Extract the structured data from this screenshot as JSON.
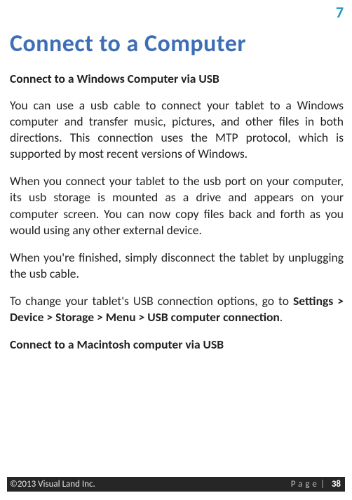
{
  "chapter_number": "7",
  "title": "Connect to a Computer",
  "sections": [
    {
      "heading": "Connect to a Windows Computer via USB",
      "paragraphs": [
        "You can use a usb cable to connect your tablet to a Windows computer and transfer music, pictures, and other files in both directions. This connection uses the MTP protocol, which is supported by most recent versions of Windows.",
        "When you connect your tablet to the usb port on your computer, its usb storage is mounted as a drive and appears on your computer screen. You can now copy files back and forth as you would using any other external device.",
        "When you're finished, simply disconnect the tablet by unplugging the usb cable."
      ],
      "para_settings_prefix": "To change your tablet's USB connection options, go to ",
      "para_settings_bold": "Settings > Device > Storage > Menu > USB computer connection",
      "para_settings_suffix": "."
    },
    {
      "heading": "Connect to a Macintosh computer via USB",
      "paragraphs": []
    }
  ],
  "footer": {
    "copyright": "©2013 Visual Land Inc.",
    "page_label": "Page",
    "separator": "|",
    "page_number": "38"
  }
}
